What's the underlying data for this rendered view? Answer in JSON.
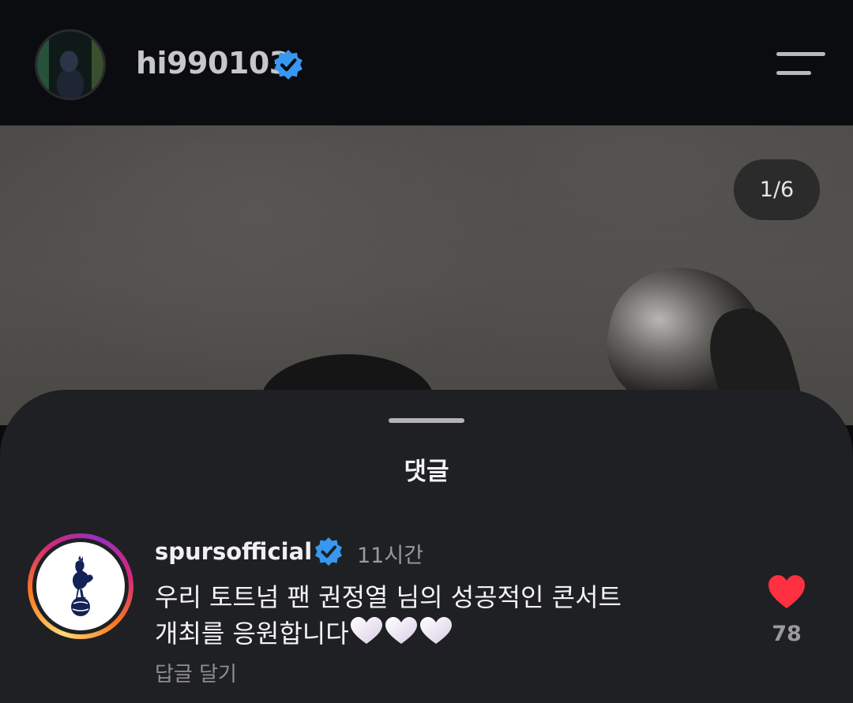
{
  "header": {
    "username": "hi990103",
    "avatar_icon": "profile-photo",
    "verified_icon": "verified-badge-icon",
    "menu_icon": "hamburger-menu-icon"
  },
  "post": {
    "page_counter": "1/6"
  },
  "comments_sheet": {
    "title": "댓글",
    "comments": [
      {
        "username": "spursofficial",
        "verified": true,
        "time": "11시간",
        "text_line1": "우리 토트넘 팬 권정열 님의 성공적인 콘서트",
        "text_line2": "개최를 응원합니다",
        "emoji_count": 3,
        "reply_label": "답글 달기",
        "like_count": "78",
        "liked": true
      }
    ]
  },
  "colors": {
    "verified_blue": "#3897f0",
    "like_red": "#ff3040",
    "sheet_bg": "#1f2024",
    "header_bg": "#0b0c0f"
  }
}
